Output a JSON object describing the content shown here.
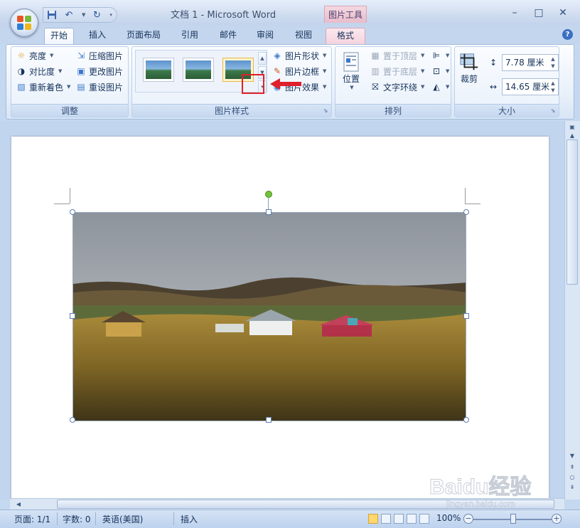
{
  "window": {
    "title": "文档 1 - Microsoft Word",
    "context_tab_title": "图片工具",
    "controls": [
      "–",
      "□",
      "✕"
    ]
  },
  "tabs": [
    {
      "label": "开始",
      "state": "active"
    },
    {
      "label": "插入"
    },
    {
      "label": "页面布局"
    },
    {
      "label": "引用"
    },
    {
      "label": "邮件"
    },
    {
      "label": "审阅"
    },
    {
      "label": "视图"
    },
    {
      "label": "格式",
      "state": "contextual"
    }
  ],
  "ribbon": {
    "adjust": {
      "label": "调整",
      "brightness": "亮度",
      "contrast": "对比度",
      "recolor": "重新着色",
      "compress": "压缩图片",
      "change": "更改图片",
      "reset": "重设图片"
    },
    "picture_styles": {
      "label": "图片样式",
      "shape": "图片形状",
      "border": "图片边框",
      "effects": "图片效果"
    },
    "arrange": {
      "label": "排列",
      "position": "位置",
      "bring_front": "置于顶层",
      "send_back": "置于底层",
      "text_wrap": "文字环绕"
    },
    "size": {
      "label": "大小",
      "crop": "裁剪",
      "height": "7.78 厘米",
      "width": "14.65 厘米"
    }
  },
  "status": {
    "page": "页面: 1/1",
    "words": "字数: 0",
    "language": "英语(美国)",
    "mode": "插入",
    "zoom": "100%"
  },
  "watermark": {
    "text": "Baidu经验",
    "url": "jingyan.baidu.com"
  },
  "colors": {
    "accent": "#e0202a",
    "context_tab": "#f4d4de",
    "ribbon_bg": "#e7eff9",
    "rotate_handle": "#72c33a"
  }
}
